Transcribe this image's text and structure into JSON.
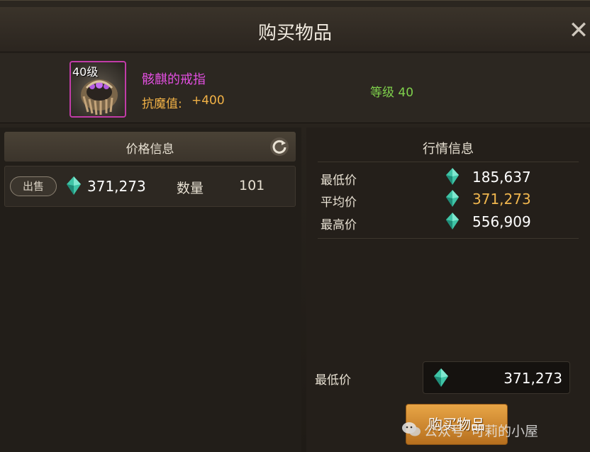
{
  "dialog": {
    "title": "购买物品",
    "close_glyph": "✕"
  },
  "item": {
    "level_badge": "40级",
    "name": "骸麒的戒指",
    "stat_label": "抗魔值:",
    "stat_value": "+400",
    "grade": "等级 40",
    "frame_color": "#c13ca7",
    "name_color": "#e24fe0"
  },
  "price_info": {
    "header": "价格信息",
    "refresh_icon": "refresh-icon",
    "listing": {
      "tag": "出售",
      "price": "371,273",
      "quantity_label": "数量",
      "quantity": "101"
    }
  },
  "market": {
    "title": "行情信息",
    "rows": [
      {
        "label": "最低价",
        "value": "185,637"
      },
      {
        "label": "平均价",
        "value": "371,273"
      },
      {
        "label": "最高价",
        "value": "556,909"
      }
    ]
  },
  "purchase": {
    "min_label": "最低价",
    "min_value": "371,273",
    "buy_label": "购买物品",
    "currency_icon": "gem-icon",
    "button_color": "#d48a32"
  },
  "watermark": {
    "text_a": "公众号",
    "text_b": "可莉的小屋"
  }
}
